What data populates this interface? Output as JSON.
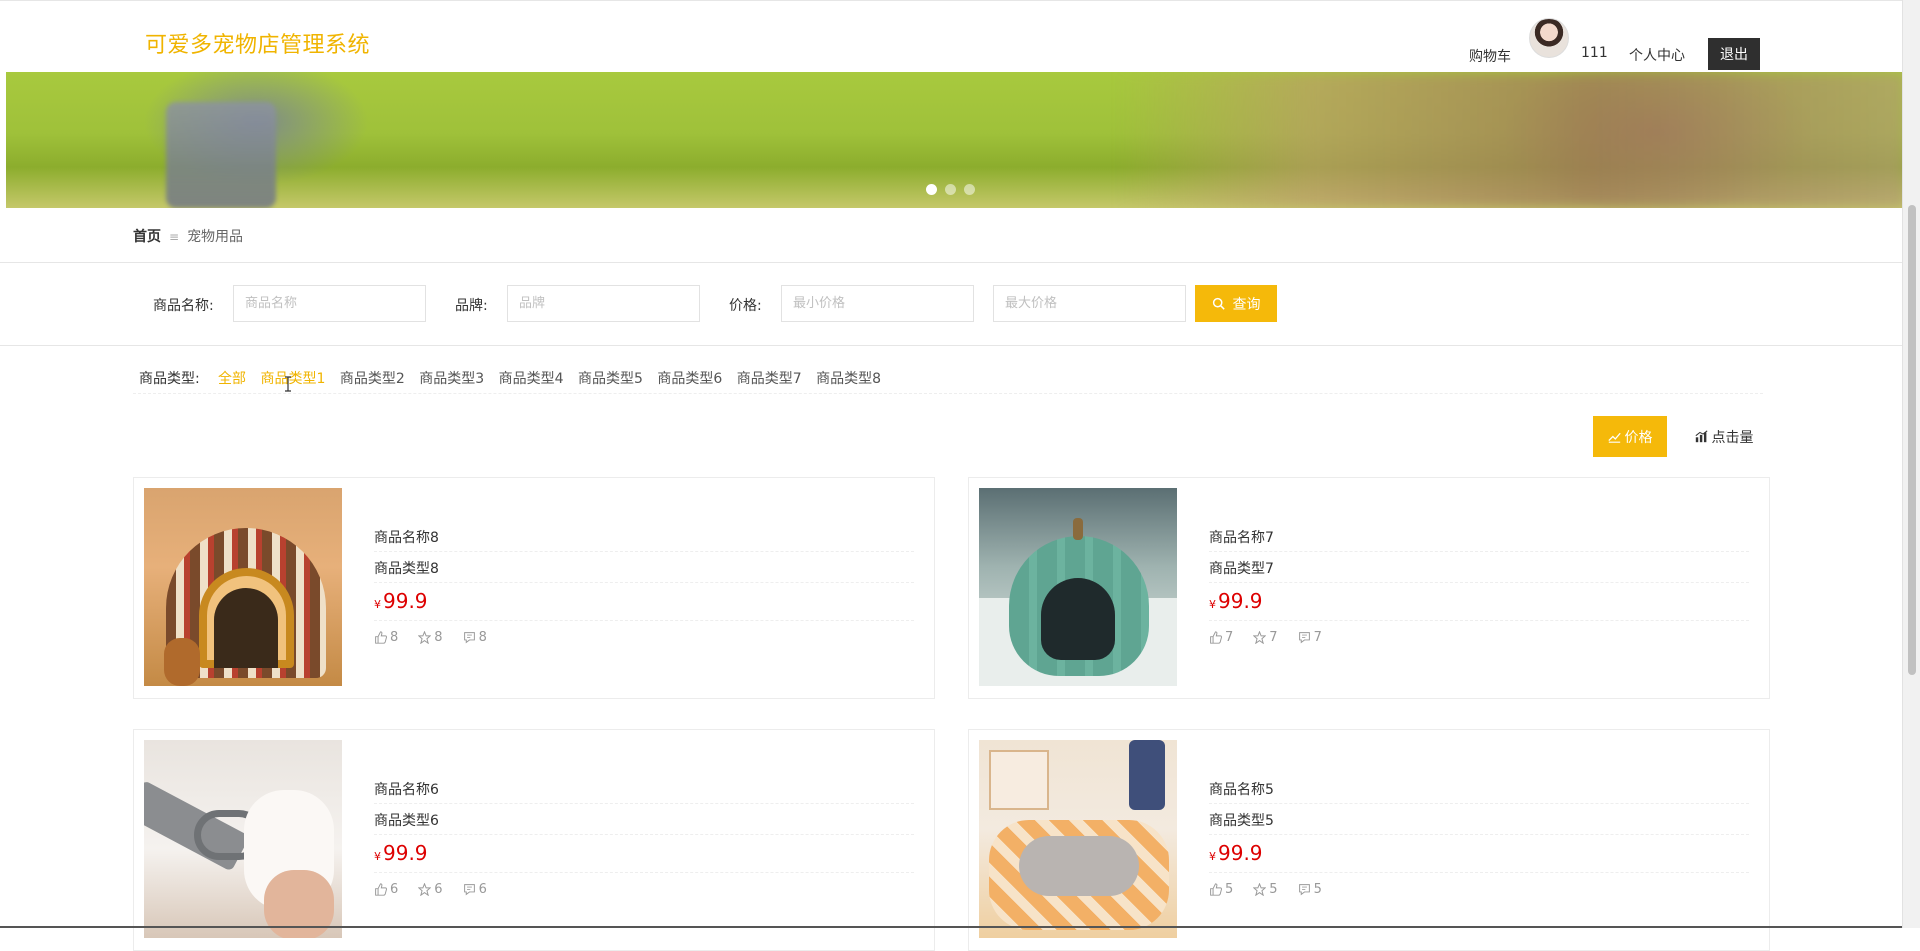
{
  "header": {
    "logo": "可爱多宠物店管理系统",
    "cart_label": "购物车",
    "username": "111",
    "profile_label": "个人中心",
    "logout_label": "退出"
  },
  "breadcrumb": {
    "home": "首页",
    "separator": "≡",
    "current": "宠物用品"
  },
  "search": {
    "name_label": "商品名称:",
    "name_placeholder": "商品名称",
    "brand_label": "品牌:",
    "brand_placeholder": "品牌",
    "price_label": "价格:",
    "min_price_placeholder": "最小价格",
    "max_price_placeholder": "最大价格",
    "button_label": "查询"
  },
  "categories": {
    "label": "商品类型:",
    "items": [
      "全部",
      "商品类型1",
      "商品类型2",
      "商品类型3",
      "商品类型4",
      "商品类型5",
      "商品类型6",
      "商品类型7",
      "商品类型8"
    ],
    "active": [
      "全部",
      "商品类型1"
    ]
  },
  "sort": {
    "price_label": "价格",
    "clicks_label": "点击量"
  },
  "products": [
    {
      "name": "商品名称8",
      "type": "商品类型8",
      "currency": "¥",
      "price": "99.9",
      "likes": "8",
      "favorites": "8",
      "comments": "8",
      "image": "striped-pet-house"
    },
    {
      "name": "商品名称7",
      "type": "商品类型7",
      "currency": "¥",
      "price": "99.9",
      "likes": "7",
      "favorites": "7",
      "comments": "7",
      "image": "green-pumpkin-cat-bed"
    },
    {
      "name": "商品名称6",
      "type": "商品类型6",
      "currency": "¥",
      "price": "99.9",
      "likes": "6",
      "favorites": "6",
      "comments": "6",
      "image": "pet-nail-clipper"
    },
    {
      "name": "商品名称5",
      "type": "商品类型5",
      "currency": "¥",
      "price": "99.9",
      "likes": "5",
      "favorites": "5",
      "comments": "5",
      "image": "plush-pet-bed"
    }
  ],
  "colors": {
    "accent": "#f5b90a",
    "price": "#dd0000",
    "logout_bg": "#2f2f2f"
  }
}
